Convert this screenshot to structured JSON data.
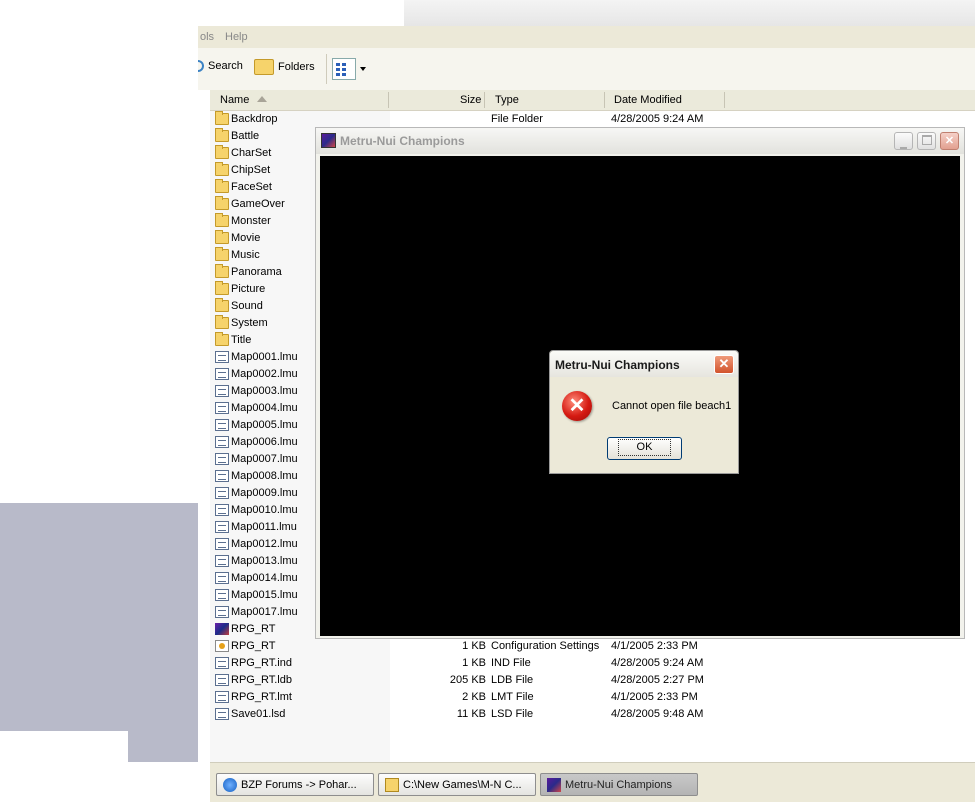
{
  "menu": {
    "tools_fragment": "ols",
    "help": "Help"
  },
  "toolbar": {
    "search": "Search",
    "folders": "Folders"
  },
  "columns": {
    "name": "Name",
    "size": "Size",
    "type": "Type",
    "date": "Date Modified"
  },
  "files": [
    {
      "name": "Backdrop",
      "size": "",
      "type": "File Folder",
      "date": "4/28/2005 9:24 AM",
      "icon": "folder-icon"
    },
    {
      "name": "Battle",
      "size": "",
      "type": "",
      "date": "",
      "icon": "folder-icon"
    },
    {
      "name": "CharSet",
      "size": "",
      "type": "",
      "date": "",
      "icon": "folder-icon"
    },
    {
      "name": "ChipSet",
      "size": "",
      "type": "",
      "date": "",
      "icon": "folder-icon"
    },
    {
      "name": "FaceSet",
      "size": "",
      "type": "",
      "date": "",
      "icon": "folder-icon"
    },
    {
      "name": "GameOver",
      "size": "",
      "type": "",
      "date": "",
      "icon": "folder-icon"
    },
    {
      "name": "Monster",
      "size": "",
      "type": "",
      "date": "",
      "icon": "folder-icon"
    },
    {
      "name": "Movie",
      "size": "",
      "type": "",
      "date": "",
      "icon": "folder-icon"
    },
    {
      "name": "Music",
      "size": "",
      "type": "",
      "date": "",
      "icon": "folder-icon"
    },
    {
      "name": "Panorama",
      "size": "",
      "type": "",
      "date": "",
      "icon": "folder-icon"
    },
    {
      "name": "Picture",
      "size": "",
      "type": "",
      "date": "",
      "icon": "folder-icon"
    },
    {
      "name": "Sound",
      "size": "",
      "type": "",
      "date": "",
      "icon": "folder-icon"
    },
    {
      "name": "System",
      "size": "",
      "type": "",
      "date": "",
      "icon": "folder-icon"
    },
    {
      "name": "Title",
      "size": "",
      "type": "",
      "date": "",
      "icon": "folder-icon"
    },
    {
      "name": "Map0001.lmu",
      "size": "",
      "type": "",
      "date": "",
      "icon": "file-icon"
    },
    {
      "name": "Map0002.lmu",
      "size": "",
      "type": "",
      "date": "",
      "icon": "file-icon"
    },
    {
      "name": "Map0003.lmu",
      "size": "",
      "type": "",
      "date": "",
      "icon": "file-icon"
    },
    {
      "name": "Map0004.lmu",
      "size": "",
      "type": "",
      "date": "",
      "icon": "file-icon"
    },
    {
      "name": "Map0005.lmu",
      "size": "",
      "type": "",
      "date": "",
      "icon": "file-icon"
    },
    {
      "name": "Map0006.lmu",
      "size": "",
      "type": "",
      "date": "",
      "icon": "file-icon"
    },
    {
      "name": "Map0007.lmu",
      "size": "",
      "type": "",
      "date": "",
      "icon": "file-icon"
    },
    {
      "name": "Map0008.lmu",
      "size": "",
      "type": "",
      "date": "",
      "icon": "file-icon"
    },
    {
      "name": "Map0009.lmu",
      "size": "",
      "type": "",
      "date": "",
      "icon": "file-icon"
    },
    {
      "name": "Map0010.lmu",
      "size": "",
      "type": "",
      "date": "",
      "icon": "file-icon"
    },
    {
      "name": "Map0011.lmu",
      "size": "",
      "type": "",
      "date": "",
      "icon": "file-icon"
    },
    {
      "name": "Map0012.lmu",
      "size": "",
      "type": "",
      "date": "",
      "icon": "file-icon"
    },
    {
      "name": "Map0013.lmu",
      "size": "",
      "type": "",
      "date": "",
      "icon": "file-icon"
    },
    {
      "name": "Map0014.lmu",
      "size": "",
      "type": "",
      "date": "",
      "icon": "file-icon"
    },
    {
      "name": "Map0015.lmu",
      "size": "",
      "type": "",
      "date": "",
      "icon": "file-icon"
    },
    {
      "name": "Map0017.lmu",
      "size": "",
      "type": "",
      "date": "",
      "icon": "file-icon"
    },
    {
      "name": "RPG_RT",
      "size": "",
      "type": "",
      "date": "",
      "icon": "app-icon"
    },
    {
      "name": "RPG_RT",
      "size": "1 KB",
      "type": "Configuration Settings",
      "date": "4/1/2005 2:33 PM",
      "icon": "config-icon"
    },
    {
      "name": "RPG_RT.ind",
      "size": "1 KB",
      "type": "IND File",
      "date": "4/28/2005 9:24 AM",
      "icon": "file-icon"
    },
    {
      "name": "RPG_RT.ldb",
      "size": "205 KB",
      "type": "LDB File",
      "date": "4/28/2005 2:27 PM",
      "icon": "file-icon"
    },
    {
      "name": "RPG_RT.lmt",
      "size": "2 KB",
      "type": "LMT File",
      "date": "4/1/2005 2:33 PM",
      "icon": "file-icon"
    },
    {
      "name": "Save01.lsd",
      "size": "11 KB",
      "type": "LSD File",
      "date": "4/28/2005 9:48 AM",
      "icon": "file-icon"
    }
  ],
  "game_window": {
    "title": "Metru-Nui Champions"
  },
  "dialog": {
    "title": "Metru-Nui Champions",
    "message": "Cannot open file beach1",
    "ok": "OK",
    "close": "✕",
    "icon": "error-icon"
  },
  "taskbar": [
    {
      "label": "BZP Forums -> Pohar...",
      "icon": "ie-icon"
    },
    {
      "label": "C:\\New Games\\M-N C...",
      "icon": "folder-icon"
    },
    {
      "label": "Metru-Nui Champions",
      "icon": "game-icon",
      "active": true
    }
  ]
}
